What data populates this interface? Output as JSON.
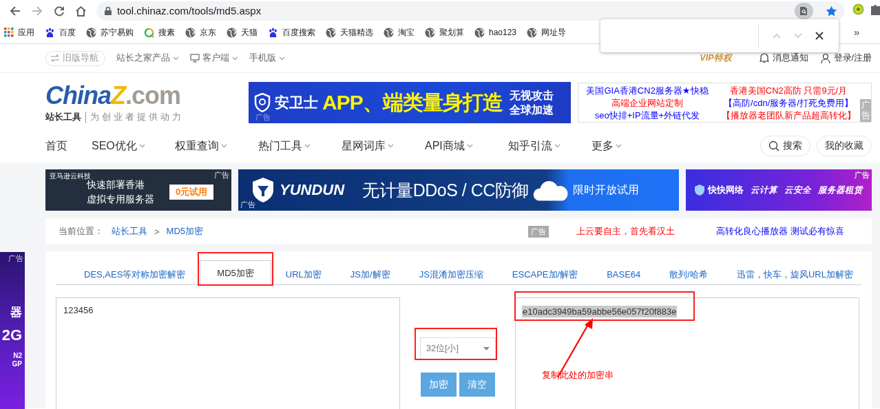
{
  "browser": {
    "url": "tool.chinaz.com/tools/md5.aspx",
    "bookmarks": [
      {
        "label": "应用",
        "kind": "apps"
      },
      {
        "label": "百度",
        "kind": "paw"
      },
      {
        "label": "苏宁易购",
        "kind": "globe"
      },
      {
        "label": "搜素",
        "kind": "ring"
      },
      {
        "label": "京东",
        "kind": "globe"
      },
      {
        "label": "天猫",
        "kind": "globe"
      },
      {
        "label": "百度搜索",
        "kind": "paw"
      },
      {
        "label": "天猫精选",
        "kind": "globe"
      },
      {
        "label": "淘宝",
        "kind": "globe"
      },
      {
        "label": "聚划算",
        "kind": "globe"
      },
      {
        "label": "hao123",
        "kind": "globe"
      },
      {
        "label": "网址导",
        "kind": "globe"
      }
    ],
    "more": "»"
  },
  "topbar": {
    "left": [
      {
        "label": "旧版导航",
        "kind": "pill"
      },
      {
        "label": "站长之家产品",
        "kind": "menu"
      },
      {
        "label": "客户端",
        "kind": "device"
      },
      {
        "label": "手机版",
        "kind": "menu"
      }
    ],
    "right": [
      {
        "label": "VIP特权",
        "kind": "vip"
      },
      {
        "label": "消息通知",
        "kind": "bell"
      },
      {
        "label": "登录/注册",
        "kind": "user"
      }
    ]
  },
  "header": {
    "logo": {
      "brand": "China",
      "mark": "Z",
      "domain": ".com",
      "tag": "站长工具",
      "slogan": "为创业者提供动力"
    },
    "banner": {
      "brand": "安卫士",
      "headline": "APP、端类量身打造",
      "sub": [
        "无视攻击",
        "全球加速"
      ],
      "ad": "广告"
    },
    "text_ads": [
      {
        "text": "美国GIA香港CN2服务器★快稳",
        "color": "#0000ff"
      },
      {
        "text": "香港美国CN2高防 只需9元/月",
        "color": "#ff0000"
      },
      {
        "text": "高端企业网站定制",
        "color": "#ff0000"
      },
      {
        "text": "【高防/cdn/服务器/打死免费用】",
        "color": "#0000ff"
      },
      {
        "text": "seo快排+IP流量+外链代发",
        "color": "#0000ff"
      },
      {
        "text": "【播放器老团队新产品超高转化】",
        "color": "#ff0000"
      }
    ],
    "text_ads_label": "广告"
  },
  "nav": {
    "items": [
      {
        "label": "首页",
        "dropdown": false
      },
      {
        "label": "SEO优化",
        "dropdown": true
      },
      {
        "label": "权重查询",
        "dropdown": true
      },
      {
        "label": "热门工具",
        "dropdown": true
      },
      {
        "label": "星网词库",
        "dropdown": true
      },
      {
        "label": "API商城",
        "dropdown": true
      },
      {
        "label": "知乎引流",
        "dropdown": true
      },
      {
        "label": "更多",
        "dropdown": true
      }
    ],
    "search": "搜索",
    "favorites": "我的收藏"
  },
  "promos": [
    {
      "kind": "cloud",
      "company": "亚马逊云科技",
      "lines": [
        "快速部署香港",
        "虚拟专用服务器"
      ],
      "button": "0元试用",
      "ad": "广告"
    },
    {
      "kind": "ddos",
      "brand": "YUNDUN",
      "headline": "无计量DDoS / CC防御",
      "button": "限时开放试用",
      "ad": "广告"
    },
    {
      "kind": "server",
      "brand": "快快网络",
      "tags": [
        "云计算",
        "云安全",
        "服务器租赁"
      ],
      "ad": "广告"
    }
  ],
  "side_ad": {
    "ad": "广告",
    "lines": [
      "器",
      "2G",
      "N2",
      "GP"
    ]
  },
  "breadcrumb": {
    "label": "当前位置：",
    "items": [
      "站长工具",
      "MD5加密"
    ],
    "separator": ">",
    "ad": "广告",
    "links": [
      {
        "text": "上云要自主，首先看汉土",
        "color": "#ff0000"
      },
      {
        "text": "高转化良心播放器 测试必有惊喜",
        "color": "#0000ff"
      }
    ]
  },
  "tabs": [
    {
      "label": "DES,AES等对称加密解密",
      "selected": false
    },
    {
      "label": "MD5加密",
      "selected": true
    },
    {
      "label": "URL加密",
      "selected": false
    },
    {
      "label": "JS加/解密",
      "selected": false
    },
    {
      "label": "JS混淆加密压缩",
      "selected": false
    },
    {
      "label": "ESCAPE加/解密",
      "selected": false
    },
    {
      "label": "BASE64",
      "selected": false
    },
    {
      "label": "散列/哈希",
      "selected": false
    },
    {
      "label": "迅雷，快车，旋风URL加解密",
      "selected": false
    }
  ],
  "tool": {
    "input": "123456",
    "length": "32位[小]",
    "buttons": [
      "加密",
      "清空"
    ],
    "output": "e10adc3949ba59abbe56e057f20f883e",
    "note": "复制此处的加密串"
  }
}
